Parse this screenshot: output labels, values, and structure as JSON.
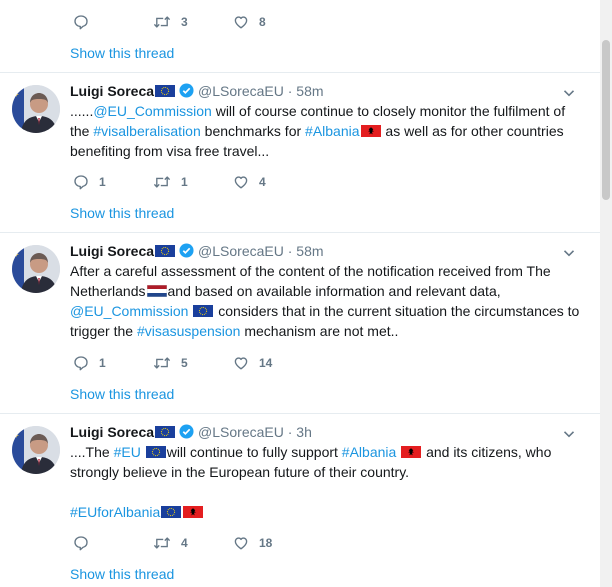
{
  "top_actions": {
    "replies": "",
    "retweets": "3",
    "likes": "8"
  },
  "show_thread_label": "Show this thread",
  "colors": {
    "link": "#1b95e0",
    "muted": "#657786",
    "text": "#14171a",
    "divider": "#e6ecf0"
  },
  "icons": {
    "reply": "reply-icon",
    "retweet": "retweet-icon",
    "like": "heart-icon",
    "verified": "verified-badge-icon",
    "more": "chevron-down-icon"
  },
  "tweets": [
    {
      "name": "Luigi Soreca",
      "handle": "@LSorecaEU",
      "dot": "·",
      "time": "58m",
      "line1_a": "......",
      "line1_link": "@EU_Commission",
      "line1_b": " will of course continue to closely monitor the fulfilment of",
      "line2_a": "the ",
      "line2_link1": "#visalberalisation",
      "line2_b": " benchmarks for ",
      "line2_link2": "#Albania",
      "line2_c": " as well as for other countries",
      "line3": "benefiting from visa free travel...",
      "replies": "1",
      "retweets": "1",
      "likes": "4"
    },
    {
      "name": "Luigi Soreca",
      "handle": "@LSorecaEU",
      "dot": "·",
      "time": "58m",
      "line1": "After a careful assessment of the content of the notification received from The",
      "line2_a": "Netherlands",
      "line2_b": "and based on available information and relevant data,",
      "line3_link": "@EU_Commission",
      "line3_b": " considers that in the current situation the circumstances to",
      "line4_a": "trigger the ",
      "line4_link": "#visasuspension",
      "line4_b": " mechanism are not met..",
      "replies": "1",
      "retweets": "5",
      "likes": "14"
    },
    {
      "name": "Luigi Soreca",
      "handle": "@LSorecaEU",
      "dot": "·",
      "time": "3h",
      "line1_a": "....The ",
      "line1_link1": "#EU",
      "line1_b": "will continue to fully support ",
      "line1_link2": "#Albania",
      "line1_c": " and its citizens, who",
      "line2": "strongly believe in the European future of their country.",
      "hashtag": "#EUforAlbania",
      "replies": "",
      "retweets": "4",
      "likes": "18"
    }
  ]
}
